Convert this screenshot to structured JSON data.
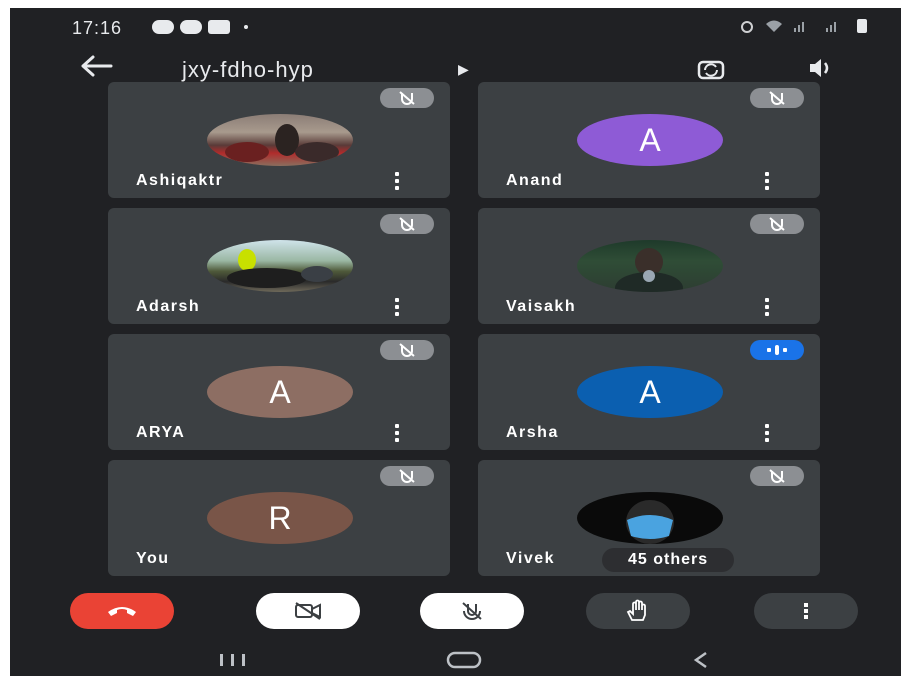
{
  "status_bar": {
    "time": "17:16"
  },
  "meeting": {
    "code": "jxy-fdho-hyp"
  },
  "participants": [
    {
      "name": "Ashiqaktr",
      "avatar_type": "photo",
      "muted": true
    },
    {
      "name": "Anand",
      "avatar_type": "initial",
      "initial": "A",
      "color": "#8e5bd6",
      "muted": true
    },
    {
      "name": "Adarsh",
      "avatar_type": "photo",
      "muted": true
    },
    {
      "name": "Vaisakh",
      "avatar_type": "photo",
      "muted": true
    },
    {
      "name": "ARYA",
      "avatar_type": "initial",
      "initial": "A",
      "color": "#8d6e63",
      "muted": true
    },
    {
      "name": "Arsha",
      "avatar_type": "initial",
      "initial": "A",
      "color": "#0b5fb0",
      "muted": false,
      "speaking": true
    },
    {
      "name": "You",
      "avatar_type": "initial",
      "initial": "R",
      "color": "#795548",
      "muted": true
    },
    {
      "name": "Vivek",
      "avatar_type": "photo",
      "muted": true
    }
  ],
  "others_chip": "45 others",
  "controls": [
    "end-call",
    "camera-off",
    "mic-off",
    "raise-hand",
    "more-options"
  ],
  "colors": {
    "background": "#202124",
    "tile": "#3c4043",
    "end_call": "#ea4335",
    "active_speaker": "#1a73e8"
  },
  "icons": [
    "back-arrow-icon",
    "caret-right-icon",
    "switch-camera-icon",
    "speaker-icon",
    "mic-off-icon",
    "more-vert-icon",
    "phone-hangup-icon",
    "camera-off-icon",
    "hand-icon"
  ]
}
